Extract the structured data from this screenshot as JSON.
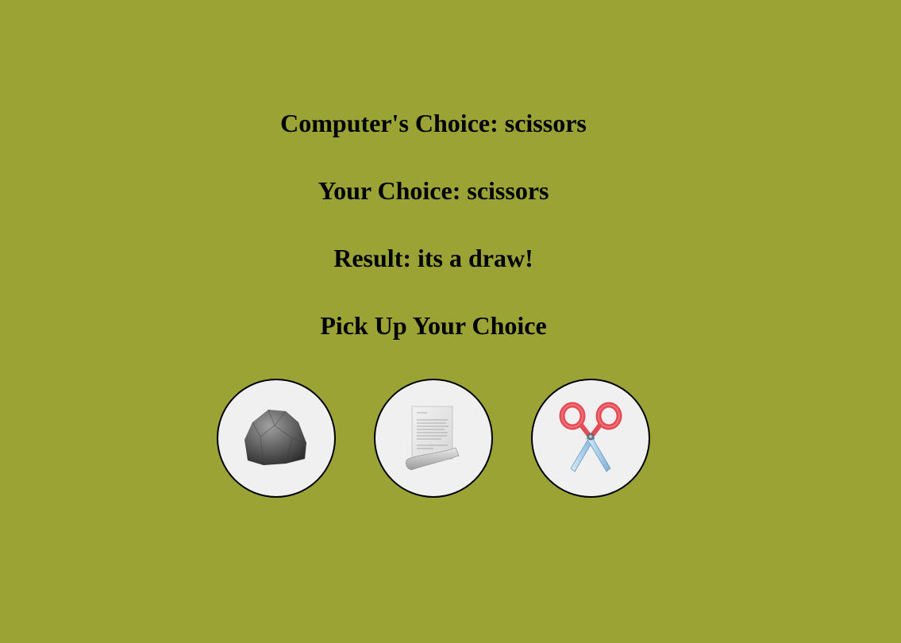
{
  "computer_choice": {
    "label": "Computer's Choice:",
    "value": "scissors"
  },
  "user_choice": {
    "label": "Your Choice:",
    "value": "scissors"
  },
  "result": {
    "label": "Result:",
    "value": "its a draw!"
  },
  "prompt": "Pick Up Your Choice",
  "choices": [
    {
      "id": "rock",
      "icon": "rock-icon"
    },
    {
      "id": "paper",
      "icon": "paper-icon"
    },
    {
      "id": "scissors",
      "icon": "scissors-icon"
    }
  ],
  "colors": {
    "background": "#9aa334",
    "button_fill": "#f0f0f0",
    "button_border": "#000000"
  }
}
